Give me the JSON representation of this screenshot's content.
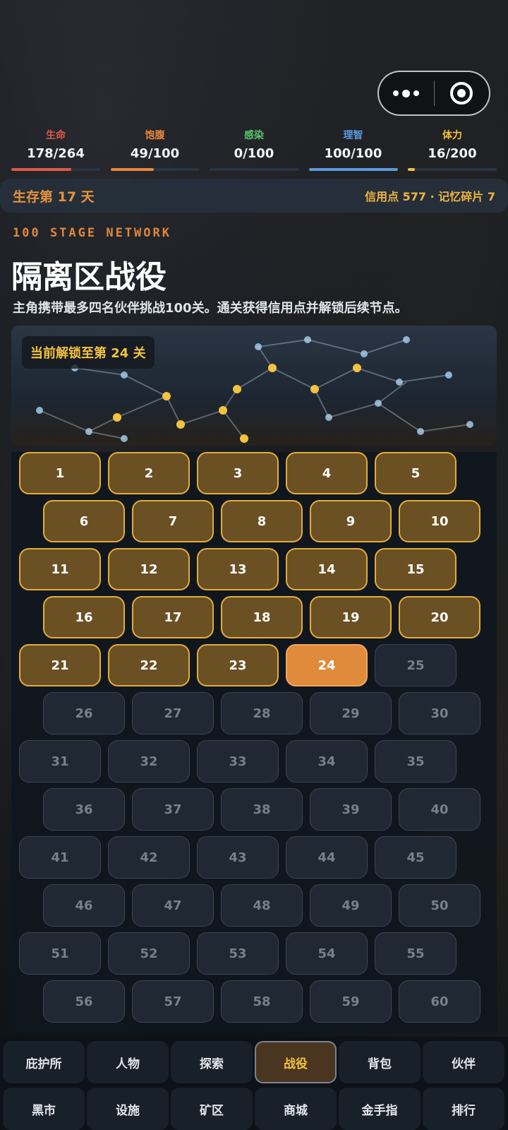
{
  "window_controls": {
    "more_icon": "more-dots-icon",
    "close_icon": "target-circle-icon"
  },
  "stats": [
    {
      "label": "生命",
      "value": "178/264",
      "fraction": 0.674,
      "color": "#e05a4a"
    },
    {
      "label": "饱腹",
      "value": "49/100",
      "fraction": 0.49,
      "color": "#e8883a"
    },
    {
      "label": "感染",
      "value": "0/100",
      "fraction": 0.0,
      "color": "#5cc46a"
    },
    {
      "label": "理智",
      "value": "100/100",
      "fraction": 1.0,
      "color": "#5b9ae0"
    },
    {
      "label": "体力",
      "value": "16/200",
      "fraction": 0.08,
      "color": "#f0c23c"
    }
  ],
  "status": {
    "day": "生存第 17 天",
    "resources": "信用点 577 · 记忆碎片 7"
  },
  "campaign": {
    "subtitle": "100 STAGE NETWORK",
    "title": "隔离区战役",
    "description": "主角携带最多四名伙伴挑战100关。通关获得信用点并解锁后续节点。",
    "unlock_badge": "当前解锁至第 24 关",
    "unlocked": 24,
    "stages": [
      "1",
      "2",
      "3",
      "4",
      "5",
      "6",
      "7",
      "8",
      "9",
      "10",
      "11",
      "12",
      "13",
      "14",
      "15",
      "16",
      "17",
      "18",
      "19",
      "20",
      "21",
      "22",
      "23",
      "24",
      "25",
      "26",
      "27",
      "28",
      "29",
      "30",
      "31",
      "32",
      "33",
      "34",
      "35",
      "36",
      "37",
      "38",
      "39",
      "40",
      "41",
      "42",
      "43",
      "44",
      "45",
      "46",
      "47",
      "48",
      "49",
      "50",
      "51",
      "52",
      "53",
      "54",
      "55",
      "56",
      "57",
      "58",
      "59",
      "60"
    ]
  },
  "nav": {
    "active": "战役",
    "tabs": [
      "庇护所",
      "人物",
      "探索",
      "战役",
      "背包",
      "伙伴",
      "黑市",
      "设施",
      "矿区",
      "商城",
      "金手指",
      "排行"
    ]
  },
  "colors": {
    "accent": "#e08a3c",
    "gold": "#f3c23e",
    "done_bg": "#6b5024",
    "locked_bg": "#1f2833"
  }
}
